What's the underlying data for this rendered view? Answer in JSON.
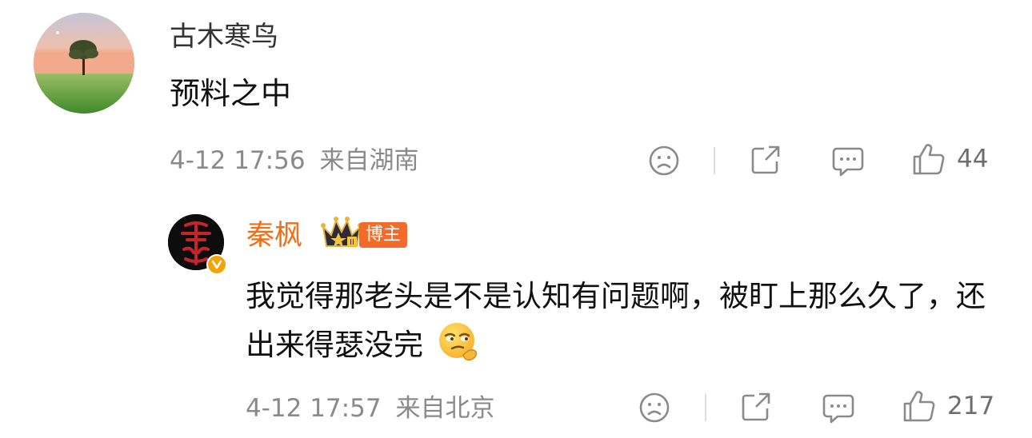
{
  "comment": {
    "username": "古木寒鸟",
    "content": "预料之中",
    "time": "4-12 17:56",
    "location": "来自湖南",
    "likes": "44",
    "icons": {
      "avatar": "tree-landscape-avatar",
      "dislike": "sad-face-icon",
      "share": "share-icon",
      "comment": "comment-bubble-icon",
      "like": "thumbs-up-icon"
    }
  },
  "reply": {
    "username": "秦枫",
    "role_badge": "博主",
    "content": "我觉得那老头是不是认知有问题啊，被盯上那么久了，还出来得瑟没完",
    "emoji": "smirk-thinking-emoji",
    "time": "4-12 17:57",
    "location": "来自北京",
    "likes": "217",
    "colors": {
      "username": "#f26d16",
      "role_badge_bg": "#f26b2b",
      "verified_badge": "#f4a300"
    }
  }
}
